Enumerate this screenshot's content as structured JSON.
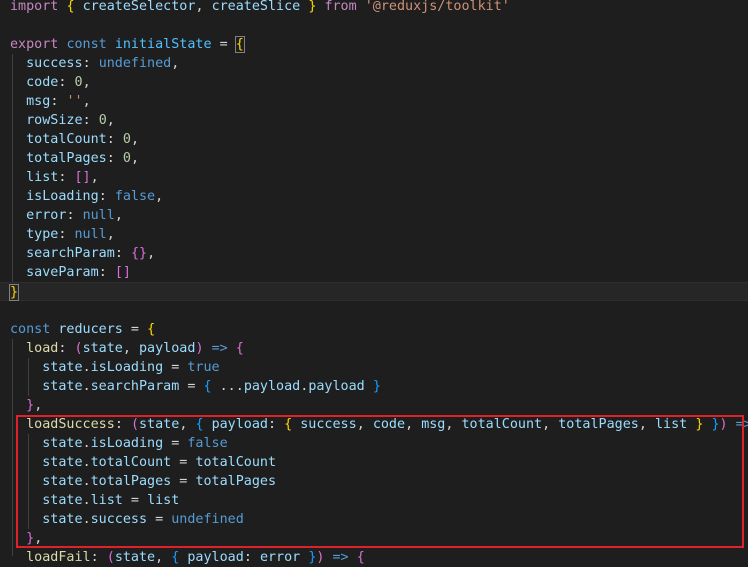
{
  "accent_colors": {
    "highlight_box": "#e0202a",
    "background": "#1e1e1e"
  },
  "code": {
    "lines": [
      [
        [
          "t-kw",
          "import"
        ],
        [
          "t-op",
          " "
        ],
        [
          "t-br1",
          "{"
        ],
        [
          "t-op",
          " "
        ],
        [
          "t-var",
          "createSelector"
        ],
        [
          "t-op",
          ", "
        ],
        [
          "t-var",
          "createSlice"
        ],
        [
          "t-op",
          " "
        ],
        [
          "t-br1",
          "}"
        ],
        [
          "t-op",
          " "
        ],
        [
          "t-kw",
          "from"
        ],
        [
          "t-op",
          " "
        ],
        [
          "t-str",
          "'@reduxjs/toolkit'"
        ]
      ],
      [],
      [
        [
          "t-kw",
          "export"
        ],
        [
          "t-op",
          " "
        ],
        [
          "t-blue",
          "const"
        ],
        [
          "t-op",
          " "
        ],
        [
          "t-const",
          "initialState"
        ],
        [
          "t-op",
          " = "
        ],
        [
          "t-br1",
          "{"
        ]
      ],
      [
        [
          "t-op",
          "  "
        ],
        [
          "t-var",
          "success"
        ],
        [
          "t-op",
          ": "
        ],
        [
          "t-blue",
          "undefined"
        ],
        [
          "t-op",
          ","
        ]
      ],
      [
        [
          "t-op",
          "  "
        ],
        [
          "t-var",
          "code"
        ],
        [
          "t-op",
          ": "
        ],
        [
          "t-num",
          "0"
        ],
        [
          "t-op",
          ","
        ]
      ],
      [
        [
          "t-op",
          "  "
        ],
        [
          "t-var",
          "msg"
        ],
        [
          "t-op",
          ": "
        ],
        [
          "t-str",
          "''"
        ],
        [
          "t-op",
          ","
        ]
      ],
      [
        [
          "t-op",
          "  "
        ],
        [
          "t-var",
          "rowSize"
        ],
        [
          "t-op",
          ": "
        ],
        [
          "t-num",
          "0"
        ],
        [
          "t-op",
          ","
        ]
      ],
      [
        [
          "t-op",
          "  "
        ],
        [
          "t-var",
          "totalCount"
        ],
        [
          "t-op",
          ": "
        ],
        [
          "t-num",
          "0"
        ],
        [
          "t-op",
          ","
        ]
      ],
      [
        [
          "t-op",
          "  "
        ],
        [
          "t-var",
          "totalPages"
        ],
        [
          "t-op",
          ": "
        ],
        [
          "t-num",
          "0"
        ],
        [
          "t-op",
          ","
        ]
      ],
      [
        [
          "t-op",
          "  "
        ],
        [
          "t-var",
          "list"
        ],
        [
          "t-op",
          ": "
        ],
        [
          "t-br2",
          "[]"
        ],
        [
          "t-op",
          ","
        ]
      ],
      [
        [
          "t-op",
          "  "
        ],
        [
          "t-var",
          "isLoading"
        ],
        [
          "t-op",
          ": "
        ],
        [
          "t-blue",
          "false"
        ],
        [
          "t-op",
          ","
        ]
      ],
      [
        [
          "t-op",
          "  "
        ],
        [
          "t-var",
          "error"
        ],
        [
          "t-op",
          ": "
        ],
        [
          "t-blue",
          "null"
        ],
        [
          "t-op",
          ","
        ]
      ],
      [
        [
          "t-op",
          "  "
        ],
        [
          "t-var",
          "type"
        ],
        [
          "t-op",
          ": "
        ],
        [
          "t-blue",
          "null"
        ],
        [
          "t-op",
          ","
        ]
      ],
      [
        [
          "t-op",
          "  "
        ],
        [
          "t-var",
          "searchParam"
        ],
        [
          "t-op",
          ": "
        ],
        [
          "t-br2",
          "{}"
        ],
        [
          "t-op",
          ","
        ]
      ],
      [
        [
          "t-op",
          "  "
        ],
        [
          "t-var",
          "saveParam"
        ],
        [
          "t-op",
          ": "
        ],
        [
          "t-br2",
          "[]"
        ]
      ],
      [
        [
          "t-br1",
          "}"
        ]
      ],
      [],
      [
        [
          "t-blue",
          "const"
        ],
        [
          "t-op",
          " "
        ],
        [
          "t-var",
          "reducers"
        ],
        [
          "t-op",
          " = "
        ],
        [
          "t-br1",
          "{"
        ]
      ],
      [
        [
          "t-op",
          "  "
        ],
        [
          "t-fn",
          "load"
        ],
        [
          "t-op",
          ": "
        ],
        [
          "t-br2",
          "("
        ],
        [
          "t-var",
          "state"
        ],
        [
          "t-op",
          ", "
        ],
        [
          "t-var",
          "payload"
        ],
        [
          "t-br2",
          ")"
        ],
        [
          "t-op",
          " "
        ],
        [
          "t-blue",
          "=>"
        ],
        [
          "t-op",
          " "
        ],
        [
          "t-br2",
          "{"
        ]
      ],
      [
        [
          "t-op",
          "    "
        ],
        [
          "t-var",
          "state"
        ],
        [
          "t-op",
          "."
        ],
        [
          "t-var",
          "isLoading"
        ],
        [
          "t-op",
          " = "
        ],
        [
          "t-blue",
          "true"
        ]
      ],
      [
        [
          "t-op",
          "    "
        ],
        [
          "t-var",
          "state"
        ],
        [
          "t-op",
          "."
        ],
        [
          "t-var",
          "searchParam"
        ],
        [
          "t-op",
          " = "
        ],
        [
          "t-br3",
          "{"
        ],
        [
          "t-op",
          " ..."
        ],
        [
          "t-var",
          "payload"
        ],
        [
          "t-op",
          "."
        ],
        [
          "t-var",
          "payload"
        ],
        [
          "t-op",
          " "
        ],
        [
          "t-br3",
          "}"
        ]
      ],
      [
        [
          "t-op",
          "  "
        ],
        [
          "t-br2",
          "}"
        ],
        [
          "t-op",
          ","
        ]
      ],
      [
        [
          "t-op",
          "  "
        ],
        [
          "t-fn",
          "loadSuccess"
        ],
        [
          "t-op",
          ": "
        ],
        [
          "t-br2",
          "("
        ],
        [
          "t-var",
          "state"
        ],
        [
          "t-op",
          ", "
        ],
        [
          "t-br3",
          "{"
        ],
        [
          "t-op",
          " "
        ],
        [
          "t-var",
          "payload"
        ],
        [
          "t-op",
          ": "
        ],
        [
          "t-br1",
          "{"
        ],
        [
          "t-op",
          " "
        ],
        [
          "t-var",
          "success"
        ],
        [
          "t-op",
          ", "
        ],
        [
          "t-var",
          "code"
        ],
        [
          "t-op",
          ", "
        ],
        [
          "t-var",
          "msg"
        ],
        [
          "t-op",
          ", "
        ],
        [
          "t-var",
          "totalCount"
        ],
        [
          "t-op",
          ", "
        ],
        [
          "t-var",
          "totalPages"
        ],
        [
          "t-op",
          ", "
        ],
        [
          "t-var",
          "list"
        ],
        [
          "t-op",
          " "
        ],
        [
          "t-br1",
          "}"
        ],
        [
          "t-op",
          " "
        ],
        [
          "t-br3",
          "}"
        ],
        [
          "t-br2",
          ")"
        ],
        [
          "t-op",
          " "
        ],
        [
          "t-blue",
          "=>"
        ],
        [
          "t-op",
          " "
        ],
        [
          "t-br2",
          "{"
        ]
      ],
      [
        [
          "t-op",
          "    "
        ],
        [
          "t-var",
          "state"
        ],
        [
          "t-op",
          "."
        ],
        [
          "t-var",
          "isLoading"
        ],
        [
          "t-op",
          " = "
        ],
        [
          "t-blue",
          "false"
        ]
      ],
      [
        [
          "t-op",
          "    "
        ],
        [
          "t-var",
          "state"
        ],
        [
          "t-op",
          "."
        ],
        [
          "t-var",
          "totalCount"
        ],
        [
          "t-op",
          " = "
        ],
        [
          "t-var",
          "totalCount"
        ]
      ],
      [
        [
          "t-op",
          "    "
        ],
        [
          "t-var",
          "state"
        ],
        [
          "t-op",
          "."
        ],
        [
          "t-var",
          "totalPages"
        ],
        [
          "t-op",
          " = "
        ],
        [
          "t-var",
          "totalPages"
        ]
      ],
      [
        [
          "t-op",
          "    "
        ],
        [
          "t-var",
          "state"
        ],
        [
          "t-op",
          "."
        ],
        [
          "t-var",
          "list"
        ],
        [
          "t-op",
          " = "
        ],
        [
          "t-var",
          "list"
        ]
      ],
      [
        [
          "t-op",
          "    "
        ],
        [
          "t-var",
          "state"
        ],
        [
          "t-op",
          "."
        ],
        [
          "t-var",
          "success"
        ],
        [
          "t-op",
          " = "
        ],
        [
          "t-blue",
          "undefined"
        ]
      ],
      [
        [
          "t-op",
          "  "
        ],
        [
          "t-br2",
          "}"
        ],
        [
          "t-op",
          ","
        ]
      ],
      [
        [
          "t-op",
          "  "
        ],
        [
          "t-fn",
          "loadFail"
        ],
        [
          "t-op",
          ": "
        ],
        [
          "t-br2",
          "("
        ],
        [
          "t-var",
          "state"
        ],
        [
          "t-op",
          ", "
        ],
        [
          "t-br3",
          "{"
        ],
        [
          "t-op",
          " "
        ],
        [
          "t-var",
          "payload"
        ],
        [
          "t-op",
          ": "
        ],
        [
          "t-var",
          "error"
        ],
        [
          "t-op",
          " "
        ],
        [
          "t-br3",
          "}"
        ],
        [
          "t-br2",
          ")"
        ],
        [
          "t-op",
          " "
        ],
        [
          "t-blue",
          "=>"
        ],
        [
          "t-op",
          " "
        ],
        [
          "t-br2",
          "{"
        ]
      ]
    ]
  }
}
